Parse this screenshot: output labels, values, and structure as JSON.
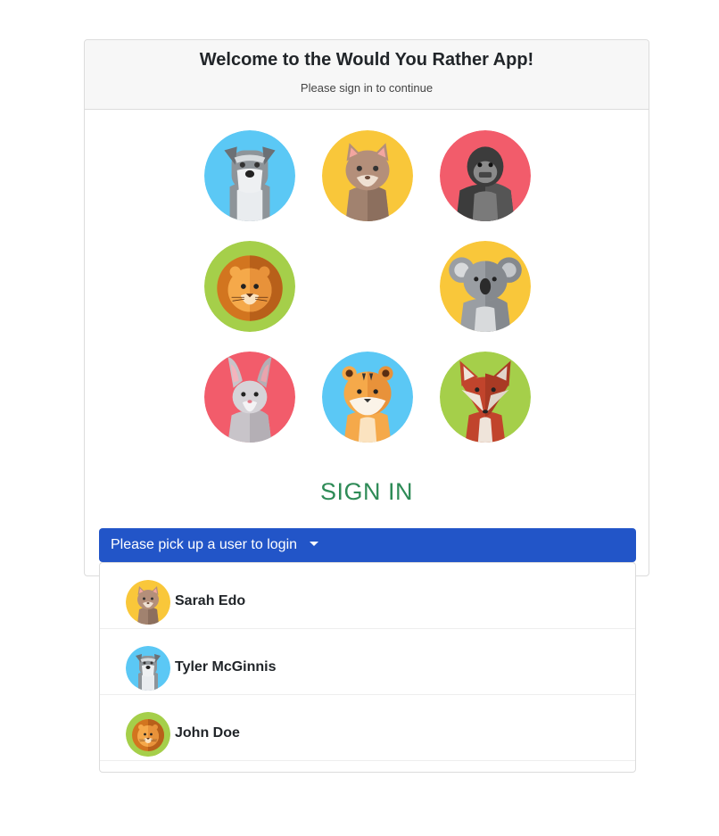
{
  "header": {
    "title": "Welcome to the Would You Rather App!",
    "subtitle": "Please sign in to continue"
  },
  "avatars": [
    {
      "icon": "schnauzer-dog-icon",
      "bg": "#5bc8f5"
    },
    {
      "icon": "cat-icon",
      "bg": "#f9c73a"
    },
    {
      "icon": "gorilla-icon",
      "bg": "#f25c6b"
    },
    {
      "icon": "lion-icon",
      "bg": "#a5cf4a"
    },
    {
      "icon": "koala-icon",
      "bg": "#f9c73a"
    },
    {
      "icon": "rabbit-icon",
      "bg": "#f25c6b"
    },
    {
      "icon": "tiger-icon",
      "bg": "#5bc8f5"
    },
    {
      "icon": "fox-icon",
      "bg": "#a5cf4a"
    }
  ],
  "signin": {
    "heading": "SIGN IN",
    "color": "#2e8b57"
  },
  "dropdown": {
    "label": "Please pick up a user to login",
    "button_color": "#2255c8",
    "users": [
      {
        "name": "Sarah Edo",
        "avatar": "cat-icon"
      },
      {
        "name": "Tyler McGinnis",
        "avatar": "schnauzer-dog-icon"
      },
      {
        "name": "John Doe",
        "avatar": "lion-icon"
      }
    ]
  }
}
